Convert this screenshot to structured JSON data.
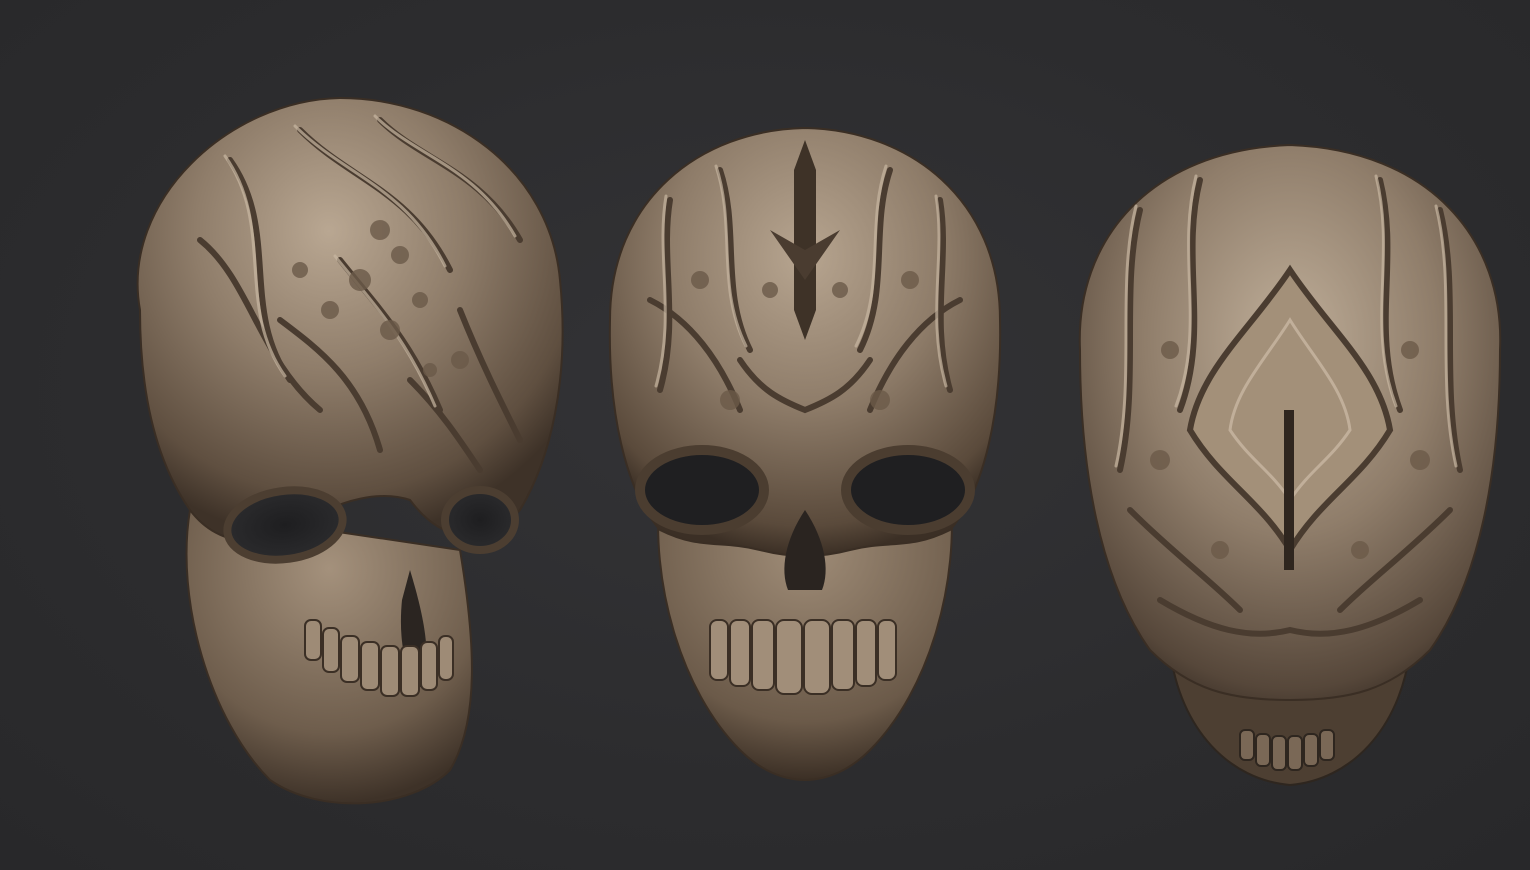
{
  "scene": {
    "background_color": "#2d2d2f",
    "material_color": "#8a7866",
    "highlight_color": "#c4b3a0",
    "shadow_color": "#3d3026"
  },
  "views": [
    {
      "name": "three-quarter-view",
      "subject": "ornate-skull"
    },
    {
      "name": "front-view",
      "subject": "ornate-skull"
    },
    {
      "name": "top-view",
      "subject": "ornate-skull"
    }
  ]
}
